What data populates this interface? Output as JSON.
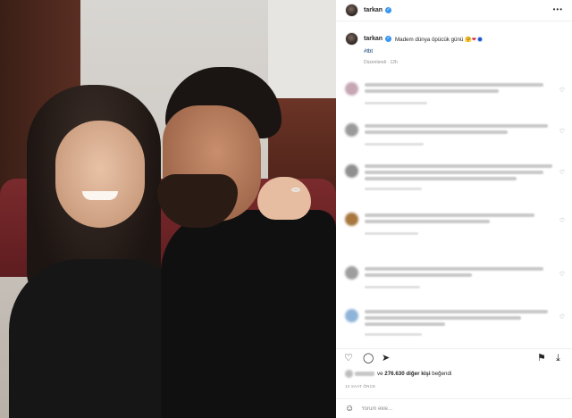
{
  "post": {
    "username": "tarkan",
    "caption_text": "Madem dünya öpücük günü",
    "caption_emoji": "🤗",
    "hashtag": "#tbt",
    "caption_meta": "Düzenlendi · 12h",
    "more_icon": "•••"
  },
  "comments": {
    "like_icon": "♡",
    "count": 6
  },
  "actions": {
    "like_icon": "♡",
    "comment_icon": "◯",
    "share_icon": "➤",
    "save_icon": "⚑",
    "download_icon": "⤓"
  },
  "likes": {
    "text_prefix": "ve",
    "count_text": "276.630 diğer kişi",
    "text_suffix": "beğendi"
  },
  "timestamp": "12 SAAT ÖNCE",
  "add_comment": {
    "placeholder": "Yorum ekle...",
    "emoji_icon": "☺"
  },
  "colors": {
    "verified": "#3897f0",
    "link": "#00376b",
    "heart": "#d3283a",
    "muted": "#8e8e8e"
  }
}
